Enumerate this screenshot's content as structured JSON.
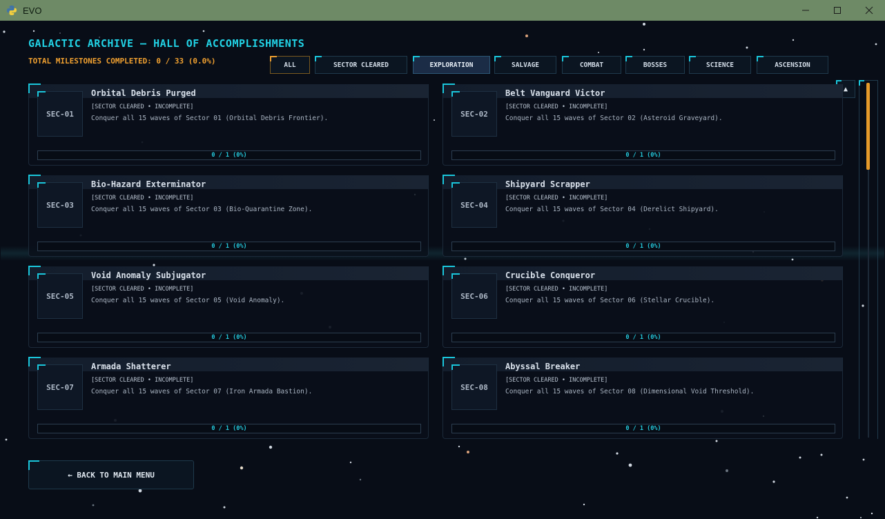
{
  "window": {
    "title": "EVO"
  },
  "header": {
    "title": "GALACTIC ARCHIVE — HALL OF ACCOMPLISHMENTS",
    "milestones_text": "TOTAL MILESTONES COMPLETED: 0 / 33 (0.0%)"
  },
  "tabs": [
    {
      "label": "ALL",
      "state": "selected-outline"
    },
    {
      "label": "SECTOR CLEARED",
      "state": "normal"
    },
    {
      "label": "EXPLORATION",
      "state": "hover"
    },
    {
      "label": "SALVAGE",
      "state": "normal"
    },
    {
      "label": "COMBAT",
      "state": "normal"
    },
    {
      "label": "BOSSES",
      "state": "normal"
    },
    {
      "label": "SCIENCE",
      "state": "normal"
    },
    {
      "label": "ASCENSION",
      "state": "normal"
    }
  ],
  "scroll_up_label": "▲",
  "cards": [
    {
      "id": "SEC-01",
      "title": "Orbital Debris Purged",
      "tag": "[SECTOR CLEARED • INCOMPLETE]",
      "desc": "Conquer all 15 waves of Sector 01 (Orbital Debris Frontier).",
      "progress": "0 / 1 (0%)"
    },
    {
      "id": "SEC-02",
      "title": "Belt Vanguard Victor",
      "tag": "[SECTOR CLEARED • INCOMPLETE]",
      "desc": "Conquer all 15 waves of Sector 02 (Asteroid Graveyard).",
      "progress": "0 / 1 (0%)"
    },
    {
      "id": "SEC-03",
      "title": "Bio-Hazard Exterminator",
      "tag": "[SECTOR CLEARED • INCOMPLETE]",
      "desc": "Conquer all 15 waves of Sector 03 (Bio-Quarantine Zone).",
      "progress": "0 / 1 (0%)"
    },
    {
      "id": "SEC-04",
      "title": "Shipyard Scrapper",
      "tag": "[SECTOR CLEARED • INCOMPLETE]",
      "desc": "Conquer all 15 waves of Sector 04 (Derelict Shipyard).",
      "progress": "0 / 1 (0%)"
    },
    {
      "id": "SEC-05",
      "title": "Void Anomaly Subjugator",
      "tag": "[SECTOR CLEARED • INCOMPLETE]",
      "desc": "Conquer all 15 waves of Sector 05 (Void Anomaly).",
      "progress": "0 / 1 (0%)"
    },
    {
      "id": "SEC-06",
      "title": "Crucible Conqueror",
      "tag": "[SECTOR CLEARED • INCOMPLETE]",
      "desc": "Conquer all 15 waves of Sector 06 (Stellar Crucible).",
      "progress": "0 / 1 (0%)"
    },
    {
      "id": "SEC-07",
      "title": "Armada Shatterer",
      "tag": "[SECTOR CLEARED • INCOMPLETE]",
      "desc": "Conquer all 15 waves of Sector 07 (Iron Armada Bastion).",
      "progress": "0 / 1 (0%)"
    },
    {
      "id": "SEC-08",
      "title": "Abyssal Breaker",
      "tag": "[SECTOR CLEARED • INCOMPLETE]",
      "desc": "Conquer all 15 waves of Sector 08 (Dimensional Void Threshold).",
      "progress": "0 / 1 (0%)"
    }
  ],
  "back_button": "← BACK TO MAIN MENU",
  "colors": {
    "accent": "#1ac7dc",
    "title": "#22d3e6",
    "milestone": "#f0a030",
    "titlebar": "#6e8a66",
    "background": "#080d17"
  }
}
